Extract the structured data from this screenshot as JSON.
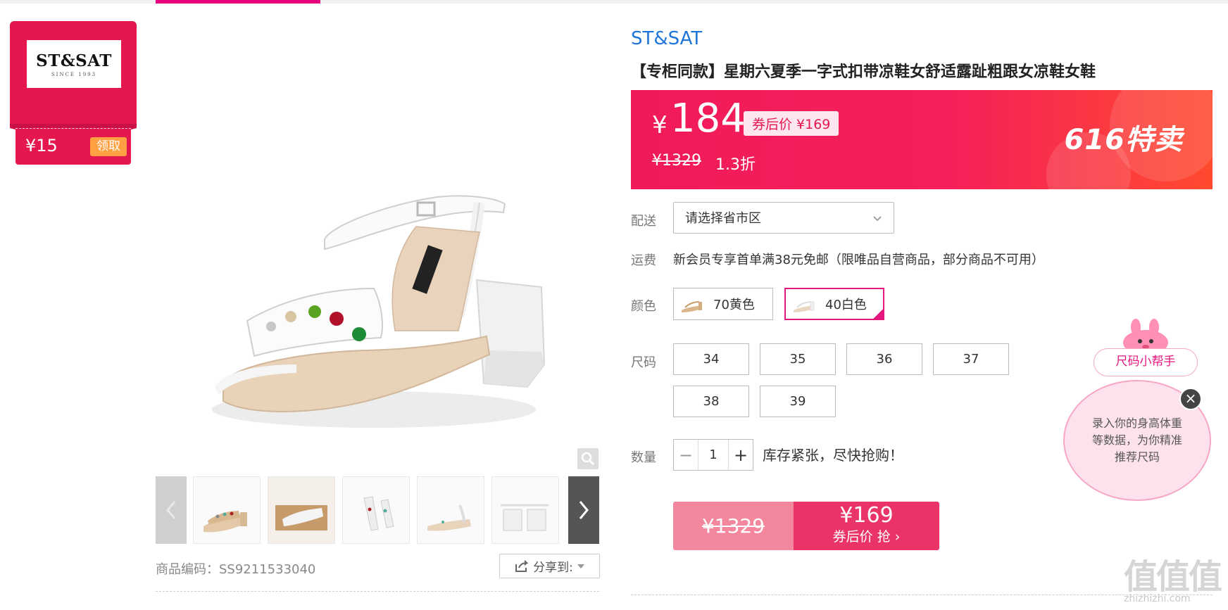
{
  "brand_card": {
    "logo_name": "ST&SAT",
    "logo_since": "SINCE 1993",
    "coupon_amount": "¥15",
    "claim_label": "领取"
  },
  "product": {
    "brand": "ST&SAT",
    "title": "【专柜同款】星期六夏季一字式扣带凉鞋女舒适露趾粗跟女凉鞋女鞋"
  },
  "price": {
    "symbol": "¥",
    "current": "184",
    "coupon_price": "券后价 ¥169",
    "original": "¥1329",
    "discount": "1.3折",
    "promo": "616特卖"
  },
  "delivery": {
    "label": "配送",
    "select_value": "请选择省市区"
  },
  "shipping": {
    "label": "运费",
    "text": "新会员专享首单满38元免邮（限唯品自营商品，部分商品不可用）"
  },
  "color": {
    "label": "颜色",
    "options": [
      "70黄色",
      "40白色"
    ],
    "selected": "40白色"
  },
  "size": {
    "label": "尺码",
    "options": [
      "34",
      "35",
      "36",
      "37",
      "38",
      "39"
    ]
  },
  "quantity": {
    "label": "数量",
    "value": "1",
    "minus": "−",
    "plus": "+",
    "stock_note": "库存紧张，尽快抢购！"
  },
  "buy": {
    "original": "¥1329",
    "price": "¥169",
    "sub": "券后价 抢 ›"
  },
  "gallery": {
    "sku_label": "商品编码：",
    "sku_value": "SS9211533040",
    "share_label": "分享到:"
  },
  "helper": {
    "tag": "尺码小帮手",
    "text": "录入你的身高体重等数据，为你精准推荐尺码",
    "close": "×"
  },
  "watermark": {
    "text": "值值值",
    "sub": "zhizhizhi.com"
  },
  "colors": {
    "accent": "#e5174f",
    "brand_link": "#1f74d8",
    "pink_border": "#e5177e",
    "coupon_orange": "#ffa143"
  }
}
